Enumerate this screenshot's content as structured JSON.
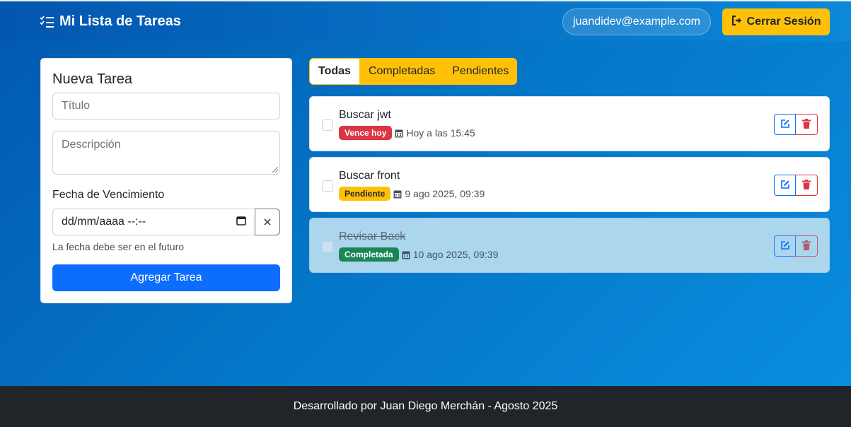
{
  "header": {
    "brand": "Mi Lista de Tareas",
    "user_email": "juandidev@example.com",
    "logout_label": "Cerrar Sesión"
  },
  "form": {
    "title": "Nueva Tarea",
    "title_placeholder": "Título",
    "description_placeholder": "Descripción",
    "date_label": "Fecha de Vencimiento",
    "date_value": "dd/mm/aaaa --:--",
    "hint": "La fecha debe ser en el futuro",
    "submit_label": "Agregar Tarea"
  },
  "filters": [
    {
      "label": "Todas",
      "active": true
    },
    {
      "label": "Completadas",
      "active": false
    },
    {
      "label": "Pendientes",
      "active": false
    }
  ],
  "tasks": [
    {
      "title": "Buscar jwt",
      "badge": "Vence hoy",
      "date": "Hoy a las 15:45",
      "completed": false
    },
    {
      "title": "Buscar front",
      "badge": "Pendiente",
      "date": "9 ago 2025, 09:39",
      "completed": false
    },
    {
      "title": "Revisar Back",
      "badge": "Completada",
      "date": "10 ago 2025, 09:39",
      "completed": true
    }
  ],
  "footer": {
    "text": "Desarrollado por Juan Diego Merchán - Agosto 2025"
  },
  "colors": {
    "primary": "#0d6efd",
    "warning": "#ffc107",
    "danger": "#dc3545",
    "success": "#198754",
    "footer_bg": "#212529"
  }
}
